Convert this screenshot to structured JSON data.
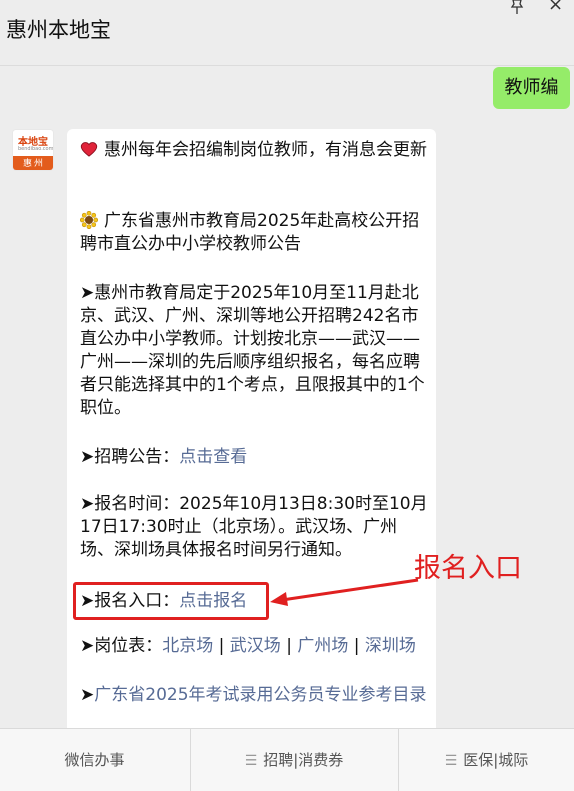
{
  "header": {
    "title": "惠州本地宝"
  },
  "sent_message": "教师编",
  "avatar": {
    "top_text": "本地宝",
    "small_text": "bendibao.com",
    "bottom_text": "惠州"
  },
  "reply": {
    "line1": "惠州每年会招编制岗位教师，有消息会更新",
    "line2": "广东省惠州市教育局2025年赴高校公开招聘市直公办中小学校教师公告",
    "line3": "➤惠州市教育局定于2025年10月至11月赴北京、武汉、广州、深圳等地公开招聘242名市直公办中小学教师。计划按北京——武汉——广州——深圳的先后顺序组织报名，每名应聘者只能选择其中的1个考点，且限报其中的1个职位。",
    "notice_label": "➤招聘公告：",
    "notice_link": "点击查看",
    "time_text": "➤报名时间：2025年10月13日8:30时至10月17日17:30时止（北京场）。武汉场、广州场、深圳场具体报名时间另行通知。",
    "entry_label": "➤报名入口：",
    "entry_link": "点击报名",
    "posts_label": "➤岗位表：",
    "posts_links": [
      "北京场",
      "武汉场",
      "广州场",
      "深圳场"
    ],
    "posts_sep": "|",
    "ref_arrow": "➤",
    "ref_link": "广东省2025年考试录用公务员专业参考目录"
  },
  "annotation": "报名入口",
  "bottom_tabs": [
    "微信办事",
    "招聘|消费券",
    "医保|城际"
  ],
  "colors": {
    "link": "#576b95",
    "highlight": "#e02020",
    "sent_bubble": "#95ec69"
  }
}
